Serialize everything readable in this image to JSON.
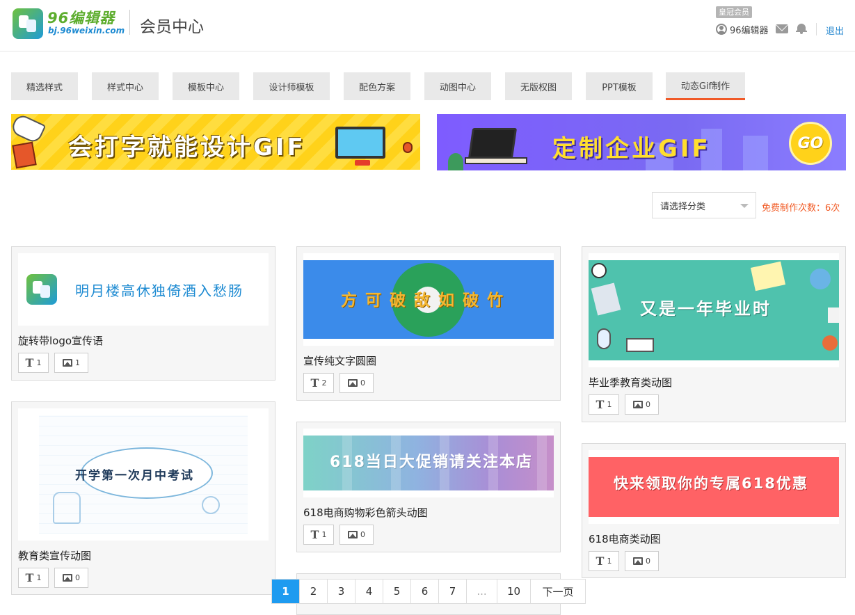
{
  "header": {
    "brand_name": "96编辑器",
    "brand_url": "bj.96weixin.com",
    "page_title": "会员中心",
    "vip_badge": "皇冠会员",
    "username": "96编辑器",
    "logout_label": "退出"
  },
  "tabs": [
    {
      "label": "精选样式"
    },
    {
      "label": "样式中心"
    },
    {
      "label": "模板中心"
    },
    {
      "label": "设计师模板"
    },
    {
      "label": "配色方案"
    },
    {
      "label": "动图中心"
    },
    {
      "label": "无版权图"
    },
    {
      "label": "PPT模板"
    },
    {
      "label": "动态Gif制作",
      "active": true
    }
  ],
  "banners": {
    "left_text": "会打字就能设计GIF",
    "right_text": "定制企业GIF",
    "right_button": "GO"
  },
  "filter": {
    "select_value": "请选择分类",
    "free_count": "免费制作次数：6次"
  },
  "cards": [
    {
      "title": "旋转带logo宣传语",
      "thumb_text": "明月楼高休独倚酒入愁肠",
      "text_count": "1",
      "image_count": "1"
    },
    {
      "title": "宣传纯文字圆圈",
      "thumb_text": "方可破敌如破竹",
      "text_count": "2",
      "image_count": "0"
    },
    {
      "title": "毕业季教育类动图",
      "thumb_text": "又是一年毕业时",
      "text_count": "1",
      "image_count": "0"
    },
    {
      "title": "教育类宣传动图",
      "thumb_text": "开学第一次月中考试",
      "text_count": "1",
      "image_count": "0"
    },
    {
      "title": "618电商购物彩色箭头动图",
      "thumb_text": "618当日大促销请关注本店",
      "text_count": "1",
      "image_count": "0"
    },
    {
      "title": "618电商类动图",
      "thumb_text": "快来领取你的专属618优惠",
      "text_count": "1",
      "image_count": "0"
    }
  ],
  "pagination": {
    "pages": [
      "1",
      "2",
      "3",
      "4",
      "5",
      "6",
      "7",
      "...",
      "10"
    ],
    "current": "1",
    "next_label": "下一页"
  },
  "colors": {
    "accent_orange": "#f05a28",
    "link_blue": "#2a8ad0",
    "pager_active": "#1e9bf0",
    "banner_yellow": "#ffd21a",
    "banner_purple": "#7e5cff"
  }
}
